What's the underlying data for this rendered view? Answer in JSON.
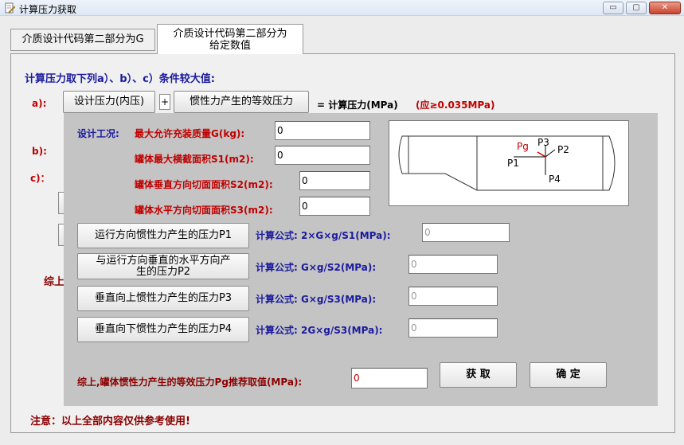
{
  "window": {
    "title": "计算压力获取",
    "minimize_label": "▭",
    "maximize_label": "▢",
    "close_label": "✕"
  },
  "tabs": [
    {
      "label": "介质设计代码第二部分为G"
    },
    {
      "label_line1": "介质设计代码第二部分为",
      "label_line2": "给定数值"
    }
  ],
  "main": {
    "heading": "计算压力取下列a）、b）、c）条件较大值:",
    "row_a_label": "a):",
    "btn_design_pressure": "设计压力(内压)",
    "plus": "+",
    "btn_inertia_pressure": "惯性力产生的等效压力",
    "eq_text": "= 计算压力(MPa)",
    "eq_hint": "(应≥0.035MPa)",
    "row_b_label": "b):",
    "row_c_label": "c)：",
    "partial_summary": "综上",
    "note": "注意：以上全部内容仅供参考使用!"
  },
  "inertia": {
    "condition_label": "设计工况:",
    "max_fill_label": "最大允许充装质量G(kg):",
    "max_fill_value": "0",
    "s1_label": "罐体最大横截面积S1(m2):",
    "s1_value": "0",
    "s2_label": "罐体垂直方向切面面积S2(m2):",
    "s2_value": "0",
    "s3_label": "罐体水平方向切面面积S3(m2):",
    "s3_value": "0",
    "p1_button": "运行方向惯性力产生的压力P1",
    "p1_formula": "计算公式: 2×G×g/S1(MPa):",
    "p1_value": "0",
    "p2_button_line1": "与运行方向垂直的水平方向产",
    "p2_button_line2": "生的压力P2",
    "p2_formula": "计算公式: G×g/S2(MPa):",
    "p2_value": "0",
    "p3_button": "垂直向上惯性力产生的压力P3",
    "p3_formula": "计算公式: G×g/S3(MPa):",
    "p3_value": "0",
    "p4_button": "垂直向下惯性力产生的压力P4",
    "p4_formula": "计算公式: 2G×g/S3(MPa):",
    "p4_value": "0",
    "summary_label": "综上,罐体惯性力产生的等效压力Pg推荐取值(MPa):",
    "summary_value": "0",
    "get_button": "获 取",
    "ok_button": "确 定"
  },
  "diagram": {
    "pg": "Pg",
    "p1": "P1",
    "p2": "P2",
    "p3": "P3",
    "p4": "P4"
  }
}
